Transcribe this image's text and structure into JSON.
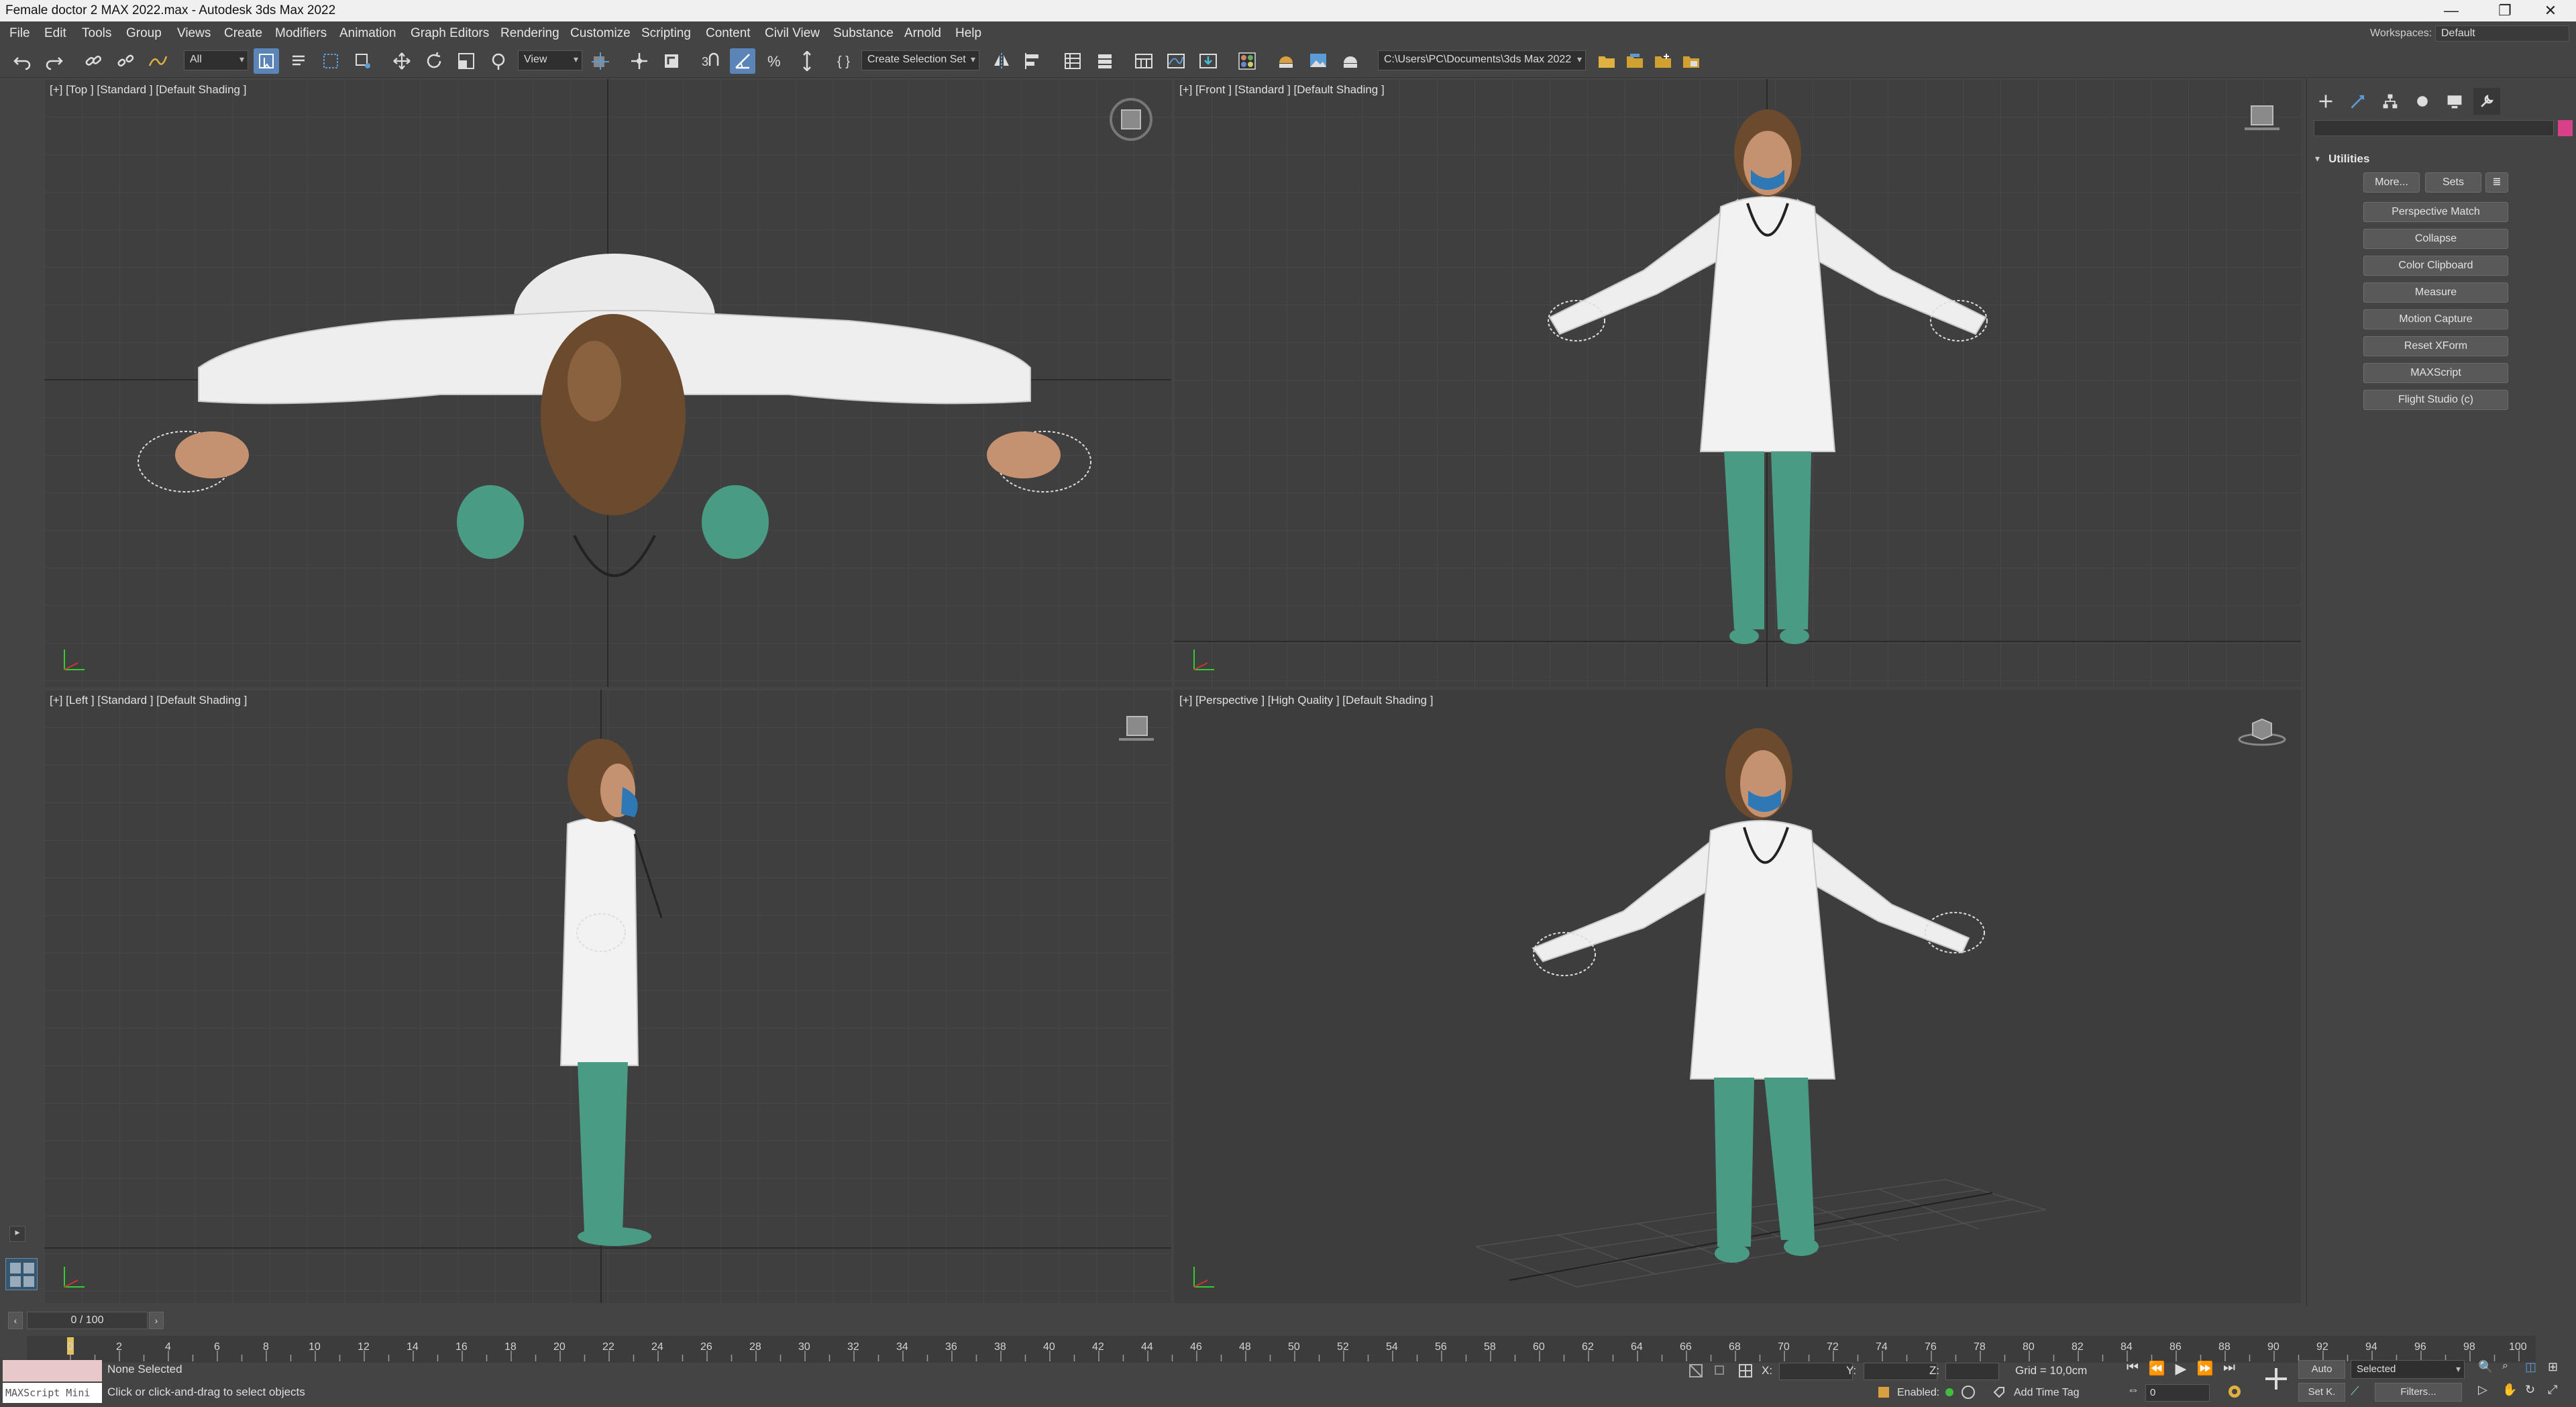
{
  "titlebar": {
    "title": "Female doctor 2 MAX 2022.max - Autodesk 3ds Max 2022",
    "minimize_icon": "minimize-icon",
    "restore_icon": "restore-icon",
    "close_icon": "close-icon"
  },
  "menubar": {
    "items": [
      "File",
      "Edit",
      "Tools",
      "Group",
      "Views",
      "Create",
      "Modifiers",
      "Animation",
      "Graph Editors",
      "Rendering",
      "Customize",
      "Scripting",
      "Content",
      "Civil View",
      "Substance",
      "Arnold",
      "Help"
    ],
    "workspaces_label": "Workspaces:",
    "workspaces_value": "Default"
  },
  "toolbar": {
    "selection_filter": "All",
    "ref_coord": "View",
    "named_selection": "Create Selection Set",
    "project_path": "C:\\Users\\PC\\Documents\\3ds Max 2022"
  },
  "viewports": {
    "top": {
      "label": "[+] [Top ] [Standard ] [Default Shading ]"
    },
    "front": {
      "label": "[+] [Front ] [Standard ] [Default Shading ]"
    },
    "left": {
      "label": "[+] [Left ] [Standard ] [Default Shading ]"
    },
    "perspective": {
      "label": "[+] [Perspective ] [High Quality ] [Default Shading ]"
    }
  },
  "command_panel": {
    "rollout_title": "Utilities",
    "more_button": "More...",
    "sets_button": "Sets",
    "utility_buttons": [
      "Perspective Match",
      "Collapse",
      "Color Clipboard",
      "Measure",
      "Motion Capture",
      "Reset XForm",
      "MAXScript",
      "Flight Studio (c)"
    ]
  },
  "timeline": {
    "slider_value": "0 / 100",
    "ticks": [
      "0",
      "2",
      "4",
      "6",
      "8",
      "10",
      "12",
      "14",
      "16",
      "18",
      "20",
      "22",
      "24",
      "26",
      "28",
      "30",
      "32",
      "34",
      "36",
      "38",
      "40",
      "42",
      "44",
      "46",
      "48",
      "50",
      "52",
      "54",
      "56",
      "58",
      "60",
      "62",
      "64",
      "66",
      "68",
      "70",
      "72",
      "74",
      "76",
      "78",
      "80",
      "82",
      "84",
      "86",
      "88",
      "90",
      "92",
      "94",
      "96",
      "98",
      "100"
    ]
  },
  "status": {
    "maxscript_label": "MAXScript Mini",
    "selection_status": "None Selected",
    "prompt": "Click or click-and-drag to select objects",
    "x_label": "X:",
    "y_label": "Y:",
    "z_label": "Z:",
    "grid": "Grid = 10,0cm",
    "enabled_label": "Enabled:",
    "add_time_tag": "Add Time Tag",
    "auto_key": "Auto",
    "set_key": "Set K.",
    "key_mode": "Selected",
    "filters": "Filters...",
    "frame_value": "0"
  },
  "colors": {
    "ui_bg": "#444444",
    "viewport_bg": "#3f3f3f",
    "active_border": "#b49b4e",
    "accent": "#5b84b8",
    "scrubs": "#4a9b84",
    "coat": "#efefef",
    "mask": "#2f78b6",
    "hair": "#6b4a2e"
  }
}
